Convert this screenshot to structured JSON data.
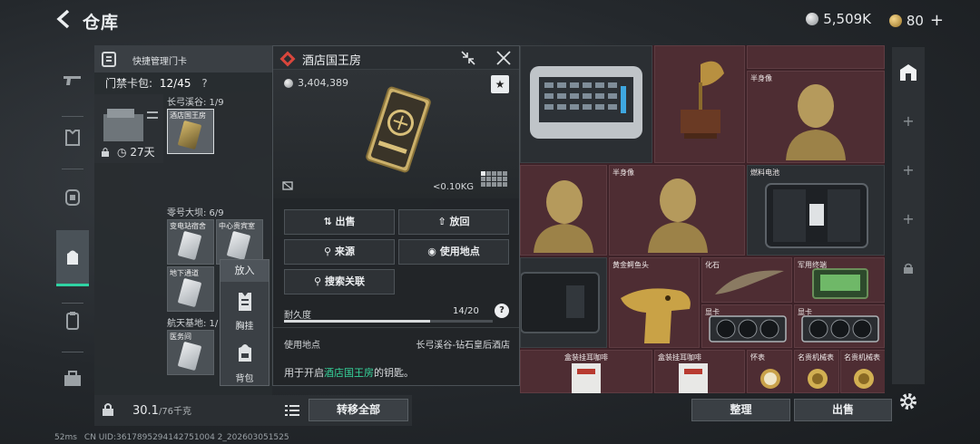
{
  "header": {
    "title": "仓库",
    "currency_1": "5,509K",
    "currency_2": "80",
    "currency_2_plus": "+"
  },
  "keypanel": {
    "title": "快捷管理门卡",
    "bag_label": "门禁卡包:",
    "bag_count": "12/45",
    "help": "?",
    "days": "27天",
    "sections": [
      {
        "label": "长弓溪谷: 1/9",
        "slots": [
          "酒店国王房"
        ]
      },
      {
        "label": "零号大坝: 6/9",
        "slots": [
          "变电站宿舍",
          "中心贵宾室",
          "地下通道",
          ""
        ]
      },
      {
        "label": "航天基地: 1/",
        "slots": [
          "医务间"
        ]
      }
    ]
  },
  "context_menu": {
    "title": "放入",
    "items": [
      "胸挂",
      "背包"
    ]
  },
  "weight": {
    "current": "30.1",
    "total": "/76千克",
    "transfer_all": "转移全部"
  },
  "detail": {
    "title": "酒店国王房",
    "price": "3,404,389",
    "fav": "★",
    "weight": "<0.10KG",
    "buttons": {
      "sell": "出售",
      "return": "放回",
      "source": "来源",
      "use_location": "使用地点",
      "search_related": "搜索关联"
    },
    "durability_label": "耐久度",
    "durability_value": "14/20",
    "durability_fraction": 0.7,
    "durability_help": "?",
    "use_label": "使用地点",
    "use_value": "长弓溪谷-钻石皇后酒店",
    "desc_prefix": "用于开启",
    "desc_highlight": "酒店国王房",
    "desc_suffix": "的钥匙。"
  },
  "stash": {
    "labels": [
      "半身像",
      "半身像",
      "燃料电池",
      "黄金鳄鱼头",
      "化石",
      "军用终端",
      "显卡",
      "显卡",
      "盒装挂耳咖啡",
      "盒装挂耳咖啡",
      "怀表",
      "名贵机械表",
      "名贵机械表"
    ],
    "sort": "整理",
    "sell": "出售"
  },
  "status": {
    "ping": "52ms",
    "uid": "CN UID:3617895294142751004 2_202603051525"
  },
  "colors": {
    "accent": "#2fd3a3",
    "stash_bg": "#4e2d33",
    "highlight_text": "#36d39a"
  }
}
